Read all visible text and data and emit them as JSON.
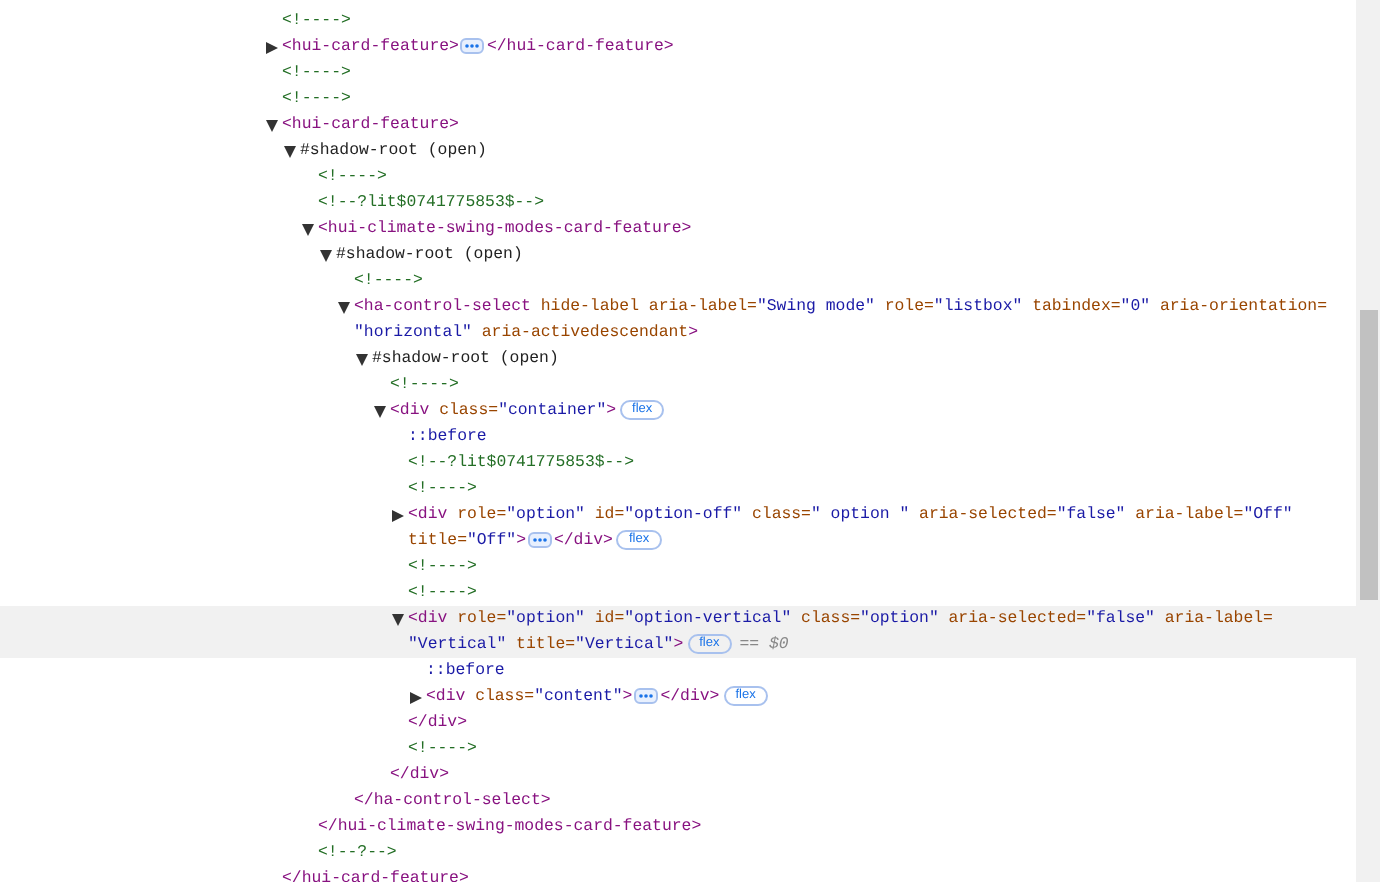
{
  "nodes": [
    {
      "kind": "comment",
      "selected": false,
      "text": "<!---->"
    },
    {
      "kind": "element",
      "selected": false,
      "expanded": false,
      "tag": "<hui-card-feature",
      "end": ">",
      "close": "</hui-card-feature>"
    },
    {
      "kind": "comment",
      "selected": false,
      "text": "<!---->"
    },
    {
      "kind": "comment",
      "selected": false,
      "text": "<!---->"
    },
    {
      "kind": "element",
      "selected": false,
      "expanded": true,
      "tag": "<hui-card-feature",
      "end": ">",
      "close": "</hui-card-feature>",
      "children": [
        {
          "kind": "shadow",
          "selected": false,
          "expanded": true,
          "text": "#shadow-root (open)",
          "children": [
            {
              "kind": "comment",
              "selected": false,
              "text": "<!---->"
            },
            {
              "kind": "comment",
              "selected": false,
              "text": "<!--?lit$0741775853$-->"
            },
            {
              "kind": "element",
              "selected": false,
              "expanded": true,
              "tag": "<hui-climate-swing-modes-card-feature",
              "end": ">",
              "close": "</hui-climate-swing-modes-card-feature>",
              "children": [
                {
                  "kind": "shadow",
                  "selected": false,
                  "expanded": true,
                  "text": "#shadow-root (open)",
                  "children": [
                    {
                      "kind": "comment",
                      "selected": false,
                      "text": "<!---->"
                    },
                    {
                      "kind": "element",
                      "selected": false,
                      "expanded": true,
                      "tag": "<ha-control-select",
                      "attrs": [
                        {
                          "name": "hide-label"
                        },
                        {
                          "name": "aria-label=",
                          "value": "\"Swing mode\""
                        },
                        {
                          "name": "role=",
                          "value": "\"listbox\""
                        },
                        {
                          "name": "tabindex=",
                          "value": "\"0\""
                        },
                        {
                          "name": "aria-orientation=",
                          "value": "\"horizontal\""
                        },
                        {
                          "name": "aria-activedescendant"
                        }
                      ],
                      "end": ">",
                      "close": "</ha-control-select>",
                      "children": [
                        {
                          "kind": "shadow",
                          "selected": false,
                          "expanded": true,
                          "text": "#shadow-root (open)",
                          "children": [
                            {
                              "kind": "comment",
                              "selected": false,
                              "text": "<!---->"
                            },
                            {
                              "kind": "element",
                              "selected": false,
                              "expanded": true,
                              "tag": "<div",
                              "attrs": [
                                {
                                  "name": "class=",
                                  "value": "\"container\""
                                }
                              ],
                              "end": ">",
                              "badges": [
                                "flex"
                              ],
                              "close": "</div>",
                              "children": [
                                {
                                  "kind": "pseudo",
                                  "selected": false,
                                  "text": "::before"
                                },
                                {
                                  "kind": "comment",
                                  "selected": false,
                                  "text": "<!--?lit$0741775853$-->"
                                },
                                {
                                  "kind": "comment",
                                  "selected": false,
                                  "text": "<!---->"
                                },
                                {
                                  "kind": "element",
                                  "selected": false,
                                  "expanded": false,
                                  "tag": "<div",
                                  "attrs": [
                                    {
                                      "name": "role=",
                                      "value": "\"option\""
                                    },
                                    {
                                      "name": "id=",
                                      "value": "\"option-off\""
                                    },
                                    {
                                      "name": "class=",
                                      "value": "\" option \""
                                    },
                                    {
                                      "name": "aria-selected=",
                                      "value": "\"false\""
                                    },
                                    {
                                      "name": "aria-label=",
                                      "value": "\"Off\""
                                    },
                                    {
                                      "name": "title=",
                                      "value": "\"Off\""
                                    }
                                  ],
                                  "end": ">",
                                  "badges": [
                                    "flex"
                                  ],
                                  "close": "</div>"
                                },
                                {
                                  "kind": "comment",
                                  "selected": false,
                                  "text": "<!---->"
                                },
                                {
                                  "kind": "comment",
                                  "selected": false,
                                  "text": "<!---->"
                                },
                                {
                                  "kind": "element",
                                  "selected": true,
                                  "expanded": true,
                                  "tag": "<div",
                                  "attrs": [
                                    {
                                      "name": "role=",
                                      "value": "\"option\""
                                    },
                                    {
                                      "name": "id=",
                                      "value": "\"option-vertical\""
                                    },
                                    {
                                      "name": "class=",
                                      "value": "\"option\""
                                    },
                                    {
                                      "name": "aria-selected=",
                                      "value": "\"false\""
                                    },
                                    {
                                      "name": "aria-label=",
                                      "value": "\"Vertical\""
                                    },
                                    {
                                      "name": "title=",
                                      "value": "\"Vertical\""
                                    }
                                  ],
                                  "end": ">",
                                  "badges": [
                                    "flex"
                                  ],
                                  "marker": "== $0",
                                  "close": "</div>",
                                  "children": [
                                    {
                                      "kind": "pseudo",
                                      "selected": false,
                                      "text": "::before"
                                    },
                                    {
                                      "kind": "element",
                                      "selected": false,
                                      "expanded": false,
                                      "tag": "<div",
                                      "attrs": [
                                        {
                                          "name": "class=",
                                          "value": "\"content\""
                                        }
                                      ],
                                      "end": ">",
                                      "badges": [
                                        "flex"
                                      ],
                                      "close": "</div>"
                                    }
                                  ]
                                },
                                {
                                  "kind": "comment",
                                  "selected": false,
                                  "text": "<!---->"
                                }
                              ]
                            }
                          ]
                        }
                      ]
                    }
                  ]
                }
              ]
            },
            {
              "kind": "comment",
              "selected": false,
              "text": "<!--?-->"
            }
          ]
        }
      ]
    }
  ]
}
